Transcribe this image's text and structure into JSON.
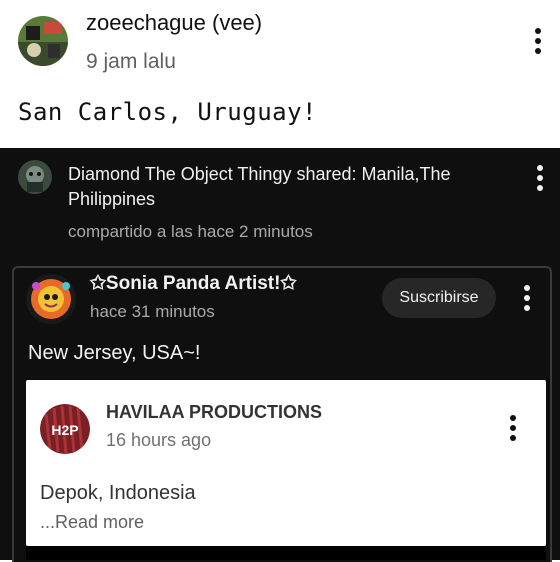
{
  "post": {
    "author": "zoeechague (vee)",
    "time": "9 jam lalu",
    "text": "San Carlos, Uruguay!"
  },
  "shared_post": {
    "header": "Diamond The Object Thingy shared: Manila,The Philippines",
    "subtext": "compartido a las hace 2 minutos",
    "card": {
      "author": "✩Sonia Panda Artist!✩",
      "time": "hace 31 minutos",
      "subscribe_label": "Suscribirse",
      "text": "New Jersey, USA~!",
      "nested": {
        "author": "HAVILAA PRODUCTIONS",
        "time": "16 hours ago",
        "text": "Depok, Indonesia",
        "read_more": "...Read more",
        "avatar_label": "H2P"
      }
    }
  },
  "icons": {
    "more": "more-vertical-icon"
  }
}
